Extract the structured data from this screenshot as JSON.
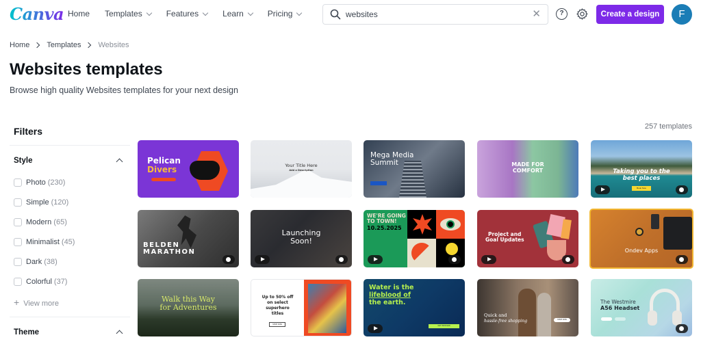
{
  "header": {
    "logo": "Canva",
    "nav": [
      {
        "label": "Home",
        "dropdown": false
      },
      {
        "label": "Templates",
        "dropdown": true
      },
      {
        "label": "Features",
        "dropdown": true
      },
      {
        "label": "Learn",
        "dropdown": true
      },
      {
        "label": "Pricing",
        "dropdown": true
      }
    ],
    "search": {
      "value": "websites",
      "icon": "search-icon",
      "clear_icon": "close-icon"
    },
    "help_icon": "help-icon",
    "help_glyph": "?",
    "settings_icon": "gear-icon",
    "create_button": "Create a design",
    "avatar_initial": "F",
    "colors": {
      "brand_purple": "#7d2ae8",
      "avatar_blue": "#1b7db6"
    }
  },
  "breadcrumb": [
    {
      "label": "Home"
    },
    {
      "label": "Templates"
    },
    {
      "label": "Websites",
      "current": true
    }
  ],
  "page": {
    "title": "Websites templates",
    "subtitle": "Browse high quality Websites templates for your next design",
    "result_count": "257 templates"
  },
  "filters": {
    "heading": "Filters",
    "sections": [
      {
        "title": "Style",
        "expanded": true,
        "options": [
          {
            "label": "Photo",
            "count": "(230)",
            "checked": false
          },
          {
            "label": "Simple",
            "count": "(120)",
            "checked": false
          },
          {
            "label": "Modern",
            "count": "(65)",
            "checked": false
          },
          {
            "label": "Minimalist",
            "count": "(45)",
            "checked": false
          },
          {
            "label": "Dark",
            "count": "(38)",
            "checked": false
          },
          {
            "label": "Colorful",
            "count": "(37)",
            "checked": false
          }
        ],
        "view_more": "View more"
      },
      {
        "title": "Theme",
        "expanded": true
      }
    ]
  },
  "templates": [
    {
      "title": "Pelican Divers",
      "line1": "Pelican",
      "line2": "Divers",
      "has_video": false,
      "pro": false
    },
    {
      "title": "Your Title Here",
      "line1": "Your Title Here",
      "line2": "Add a Description",
      "has_video": false,
      "pro": false
    },
    {
      "title": "Mega Media Summit",
      "line1": "Mega Media",
      "line2": "Summit",
      "has_video": false,
      "pro": false
    },
    {
      "title": "Made For Comfort",
      "line1": "MADE FOR",
      "line2": "COMFORT",
      "has_video": false,
      "pro": false
    },
    {
      "title": "Taking you to the best places",
      "line1": "Taking you to the",
      "line2": "best places",
      "button": "Book Now",
      "has_video": true,
      "pro": true
    },
    {
      "title": "Belden Marathon",
      "line1": "BELDEN",
      "line2": "MARATHON",
      "has_video": false,
      "pro": true
    },
    {
      "title": "Launching Soon!",
      "line1": "Launching",
      "line2": "Soon!",
      "has_video": true,
      "pro": true
    },
    {
      "title": "We're Going To Town! 10.25.2025",
      "line1": "WE'RE GOING",
      "line2": "TO TOWN!",
      "line3": "10.25.2025",
      "has_video": true,
      "pro": true
    },
    {
      "title": "Project and Goal Updates",
      "line1": "Project and",
      "line2": "Goal Updates",
      "has_video": true,
      "pro": true
    },
    {
      "title": "Ondev Apps",
      "line1": "Ondev Apps",
      "has_video": false,
      "pro": true
    },
    {
      "title": "Walk this Way for Adventures",
      "line1": "Walk this Way",
      "line2": "for Adventures",
      "has_video": false,
      "pro": false
    },
    {
      "title": "Up to 50% off on select superhero titles",
      "line1": "Up to 50% off",
      "line2": "on select",
      "line3": "superhero",
      "line4": "titles",
      "button": "SHOP NOW",
      "has_video": false,
      "pro": false
    },
    {
      "title": "Water is the lifeblood of the earth.",
      "line1": "Water is the",
      "line2": "lifeblood of",
      "line3": "the earth.",
      "button": "GET INVOLVED",
      "has_video": true,
      "pro": false
    },
    {
      "title": "Quick and hassle-free shopping",
      "line1": "Quick and",
      "line2": "hassle-free shopping",
      "button": "SHOP NOW",
      "has_video": false,
      "pro": false
    },
    {
      "title": "The Westmire A56 Headset",
      "line1": "The Westmire",
      "line2": "A56 Headset",
      "has_video": false,
      "pro": true
    }
  ]
}
